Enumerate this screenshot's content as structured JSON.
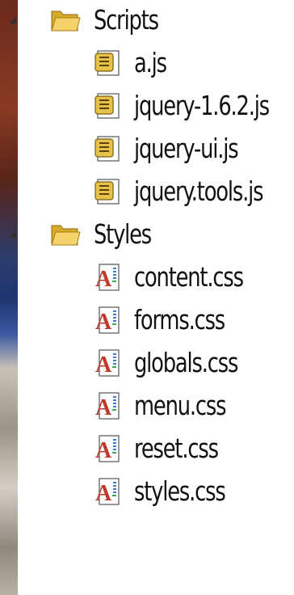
{
  "tree": {
    "folders": [
      {
        "name": "Scripts",
        "expanded": true,
        "icon": "folder-open-icon",
        "files": [
          {
            "name": "a.js",
            "icon": "javascript-file-icon"
          },
          {
            "name": "jquery-1.6.2.js",
            "icon": "javascript-file-icon"
          },
          {
            "name": "jquery-ui.js",
            "icon": "javascript-file-icon"
          },
          {
            "name": "jquery.tools.js",
            "icon": "javascript-file-icon"
          }
        ]
      },
      {
        "name": "Styles",
        "expanded": true,
        "icon": "folder-open-icon",
        "files": [
          {
            "name": "content.css",
            "icon": "css-file-icon"
          },
          {
            "name": "forms.css",
            "icon": "css-file-icon"
          },
          {
            "name": "globals.css",
            "icon": "css-file-icon"
          },
          {
            "name": "menu.css",
            "icon": "css-file-icon"
          },
          {
            "name": "reset.css",
            "icon": "css-file-icon"
          },
          {
            "name": "styles.css",
            "icon": "css-file-icon"
          }
        ]
      }
    ]
  },
  "colors": {
    "folder": "#f2c94c",
    "folder_dark": "#c79a1e",
    "js_icon": "#e6c24a",
    "css_letter": "#c0392b",
    "text": "#111111"
  }
}
